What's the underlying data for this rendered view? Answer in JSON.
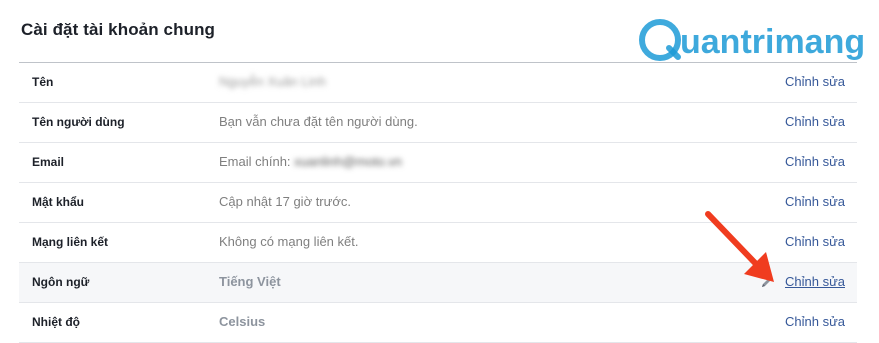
{
  "page": {
    "title": "Cài đặt tài khoản chung"
  },
  "watermark": {
    "logo_text": "Quantrimang",
    "color": "#1d9bd7"
  },
  "settings": {
    "rows": [
      {
        "label": "Tên",
        "value": "Nguyễn Xuân Linh",
        "value_blurred": true,
        "edit_label": "Chỉnh sửa"
      },
      {
        "label": "Tên người dùng",
        "value": "Bạn vẫn chưa đặt tên người dùng.",
        "edit_label": "Chỉnh sửa"
      },
      {
        "label": "Email",
        "value_prefix": "Email chính:",
        "value": "xuanlinh@moto.vn",
        "value_blurred": true,
        "edit_label": "Chỉnh sửa"
      },
      {
        "label": "Mật khẩu",
        "value": "Cập nhật 17 giờ trước.",
        "edit_label": "Chỉnh sửa"
      },
      {
        "label": "Mạng liên kết",
        "value": "Không có mạng liên kết.",
        "edit_label": "Chỉnh sửa"
      },
      {
        "label": "Ngôn ngữ",
        "value": "Tiếng Việt",
        "edit_label": "Chỉnh sửa",
        "hovered": true,
        "icon": "pencil-icon"
      },
      {
        "label": "Nhiệt độ",
        "value": "Celsius",
        "edit_label": "Chỉnh sửa"
      }
    ]
  },
  "annotation": {
    "icon": "red-arrow-icon",
    "color": "#f03c1f"
  },
  "colors": {
    "link": "#365899",
    "label": "#1d2129",
    "value": "#7f7f7f",
    "row_divider": "#e4e6ea",
    "hover_row": "#f6f7f9"
  }
}
